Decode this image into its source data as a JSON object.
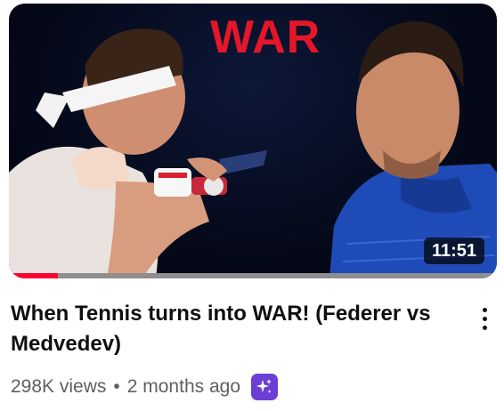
{
  "video": {
    "thumbnail": {
      "overlay_text": "WAR",
      "duration": "11:51",
      "watch_progress": 0.1
    },
    "title": "When Tennis turns into WAR! (Federer vs Medvedev)",
    "views": "298K views",
    "separator": "•",
    "age": "2 months ago",
    "badge_icon": "sparkle-icon"
  },
  "colors": {
    "progress": "#ff0033",
    "badge": "#6b3fd6",
    "overlay_text": "#e3162a"
  }
}
